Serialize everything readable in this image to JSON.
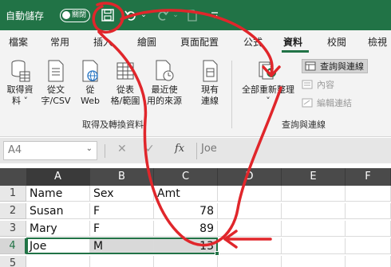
{
  "titlebar": {
    "autosave_label": "自動儲存",
    "autosave_toggle": "關閉"
  },
  "tabs": [
    "檔案",
    "常用",
    "插入",
    "繪圖",
    "頁面配置",
    "公式",
    "資料",
    "校閱",
    "檢視"
  ],
  "active_tab": "資料",
  "ribbon": {
    "get_transform": {
      "buttons": [
        {
          "line1": "取得資",
          "line2": "料 ˅"
        },
        {
          "line1": "從文",
          "line2": "字/CSV"
        },
        {
          "line1": "從",
          "line2": "Web"
        },
        {
          "line1": "從表",
          "line2": "格/範圍"
        },
        {
          "line1": "最近使",
          "line2": "用的來源"
        },
        {
          "line1": "現有",
          "line2": "連線"
        }
      ],
      "group_label": "取得及轉換資料"
    },
    "queries": {
      "refresh_all": "全部重新整理",
      "queries_connections": "查詢與連線",
      "properties": "內容",
      "edit_links": "編輯連結",
      "group_label": "查詢與連線"
    }
  },
  "formula_bar": {
    "name_box": "A4",
    "fx": "fx",
    "cancel": "✕",
    "enter": "✓",
    "formula": "Joe"
  },
  "grid": {
    "columns": [
      "A",
      "B",
      "C",
      "D",
      "E",
      "F"
    ],
    "rows": [
      {
        "num": "1",
        "a": "Name",
        "b": "Sex",
        "c": "Amt"
      },
      {
        "num": "2",
        "a": "Susan",
        "b": "F",
        "c": "78"
      },
      {
        "num": "3",
        "a": "Mary",
        "b": "F",
        "c": "89"
      },
      {
        "num": "4",
        "a": "Joe",
        "b": "M",
        "c": "13"
      },
      {
        "num": "5",
        "a": "",
        "b": "",
        "c": ""
      }
    ],
    "active_cell": "A4"
  },
  "colors": {
    "excel_green": "#217346",
    "annotation_red": "#e0262b"
  }
}
